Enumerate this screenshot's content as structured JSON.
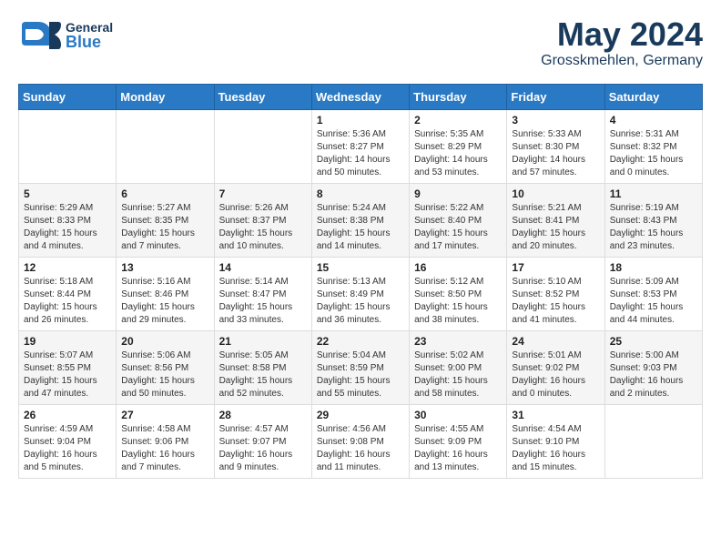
{
  "header": {
    "logo_general": "General",
    "logo_blue": "Blue",
    "month": "May 2024",
    "location": "Grosskmehlen, Germany"
  },
  "weekdays": [
    "Sunday",
    "Monday",
    "Tuesday",
    "Wednesday",
    "Thursday",
    "Friday",
    "Saturday"
  ],
  "weeks": [
    [
      {
        "day": "",
        "info": ""
      },
      {
        "day": "",
        "info": ""
      },
      {
        "day": "",
        "info": ""
      },
      {
        "day": "1",
        "info": "Sunrise: 5:36 AM\nSunset: 8:27 PM\nDaylight: 14 hours\nand 50 minutes."
      },
      {
        "day": "2",
        "info": "Sunrise: 5:35 AM\nSunset: 8:29 PM\nDaylight: 14 hours\nand 53 minutes."
      },
      {
        "day": "3",
        "info": "Sunrise: 5:33 AM\nSunset: 8:30 PM\nDaylight: 14 hours\nand 57 minutes."
      },
      {
        "day": "4",
        "info": "Sunrise: 5:31 AM\nSunset: 8:32 PM\nDaylight: 15 hours\nand 0 minutes."
      }
    ],
    [
      {
        "day": "5",
        "info": "Sunrise: 5:29 AM\nSunset: 8:33 PM\nDaylight: 15 hours\nand 4 minutes."
      },
      {
        "day": "6",
        "info": "Sunrise: 5:27 AM\nSunset: 8:35 PM\nDaylight: 15 hours\nand 7 minutes."
      },
      {
        "day": "7",
        "info": "Sunrise: 5:26 AM\nSunset: 8:37 PM\nDaylight: 15 hours\nand 10 minutes."
      },
      {
        "day": "8",
        "info": "Sunrise: 5:24 AM\nSunset: 8:38 PM\nDaylight: 15 hours\nand 14 minutes."
      },
      {
        "day": "9",
        "info": "Sunrise: 5:22 AM\nSunset: 8:40 PM\nDaylight: 15 hours\nand 17 minutes."
      },
      {
        "day": "10",
        "info": "Sunrise: 5:21 AM\nSunset: 8:41 PM\nDaylight: 15 hours\nand 20 minutes."
      },
      {
        "day": "11",
        "info": "Sunrise: 5:19 AM\nSunset: 8:43 PM\nDaylight: 15 hours\nand 23 minutes."
      }
    ],
    [
      {
        "day": "12",
        "info": "Sunrise: 5:18 AM\nSunset: 8:44 PM\nDaylight: 15 hours\nand 26 minutes."
      },
      {
        "day": "13",
        "info": "Sunrise: 5:16 AM\nSunset: 8:46 PM\nDaylight: 15 hours\nand 29 minutes."
      },
      {
        "day": "14",
        "info": "Sunrise: 5:14 AM\nSunset: 8:47 PM\nDaylight: 15 hours\nand 33 minutes."
      },
      {
        "day": "15",
        "info": "Sunrise: 5:13 AM\nSunset: 8:49 PM\nDaylight: 15 hours\nand 36 minutes."
      },
      {
        "day": "16",
        "info": "Sunrise: 5:12 AM\nSunset: 8:50 PM\nDaylight: 15 hours\nand 38 minutes."
      },
      {
        "day": "17",
        "info": "Sunrise: 5:10 AM\nSunset: 8:52 PM\nDaylight: 15 hours\nand 41 minutes."
      },
      {
        "day": "18",
        "info": "Sunrise: 5:09 AM\nSunset: 8:53 PM\nDaylight: 15 hours\nand 44 minutes."
      }
    ],
    [
      {
        "day": "19",
        "info": "Sunrise: 5:07 AM\nSunset: 8:55 PM\nDaylight: 15 hours\nand 47 minutes."
      },
      {
        "day": "20",
        "info": "Sunrise: 5:06 AM\nSunset: 8:56 PM\nDaylight: 15 hours\nand 50 minutes."
      },
      {
        "day": "21",
        "info": "Sunrise: 5:05 AM\nSunset: 8:58 PM\nDaylight: 15 hours\nand 52 minutes."
      },
      {
        "day": "22",
        "info": "Sunrise: 5:04 AM\nSunset: 8:59 PM\nDaylight: 15 hours\nand 55 minutes."
      },
      {
        "day": "23",
        "info": "Sunrise: 5:02 AM\nSunset: 9:00 PM\nDaylight: 15 hours\nand 58 minutes."
      },
      {
        "day": "24",
        "info": "Sunrise: 5:01 AM\nSunset: 9:02 PM\nDaylight: 16 hours\nand 0 minutes."
      },
      {
        "day": "25",
        "info": "Sunrise: 5:00 AM\nSunset: 9:03 PM\nDaylight: 16 hours\nand 2 minutes."
      }
    ],
    [
      {
        "day": "26",
        "info": "Sunrise: 4:59 AM\nSunset: 9:04 PM\nDaylight: 16 hours\nand 5 minutes."
      },
      {
        "day": "27",
        "info": "Sunrise: 4:58 AM\nSunset: 9:06 PM\nDaylight: 16 hours\nand 7 minutes."
      },
      {
        "day": "28",
        "info": "Sunrise: 4:57 AM\nSunset: 9:07 PM\nDaylight: 16 hours\nand 9 minutes."
      },
      {
        "day": "29",
        "info": "Sunrise: 4:56 AM\nSunset: 9:08 PM\nDaylight: 16 hours\nand 11 minutes."
      },
      {
        "day": "30",
        "info": "Sunrise: 4:55 AM\nSunset: 9:09 PM\nDaylight: 16 hours\nand 13 minutes."
      },
      {
        "day": "31",
        "info": "Sunrise: 4:54 AM\nSunset: 9:10 PM\nDaylight: 16 hours\nand 15 minutes."
      },
      {
        "day": "",
        "info": ""
      }
    ]
  ]
}
